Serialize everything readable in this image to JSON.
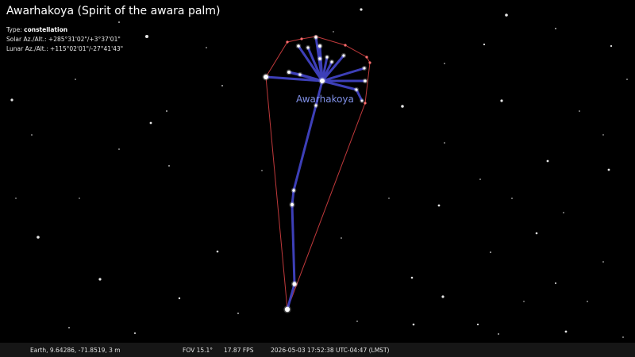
{
  "object_info": {
    "title": "Awarhakoya (Spirit of the awara palm)",
    "type_label": "Type:",
    "type_value": "constellation",
    "solar": "Solar Az./Alt.: +285°31'02\"/+3°37'01\"",
    "lunar": "Lunar Az./Alt.: +115°02'01\"/-27°41'43\""
  },
  "constellation": {
    "label": "Awarhakoya",
    "line_color": "#3d3fb8",
    "boundary_color": "#c0393b",
    "label_color": "#7f8fe6"
  },
  "status_bar": {
    "location": "Earth, 9.64286, -71.8519, 3 m",
    "fov": "FOV 15.1°",
    "fps": "17.87 FPS",
    "datetime": "2026-05-03 17:52:38 UTC-04:47 (LMST)"
  },
  "colors": {
    "background": "#000000",
    "star": "#ffffff"
  }
}
